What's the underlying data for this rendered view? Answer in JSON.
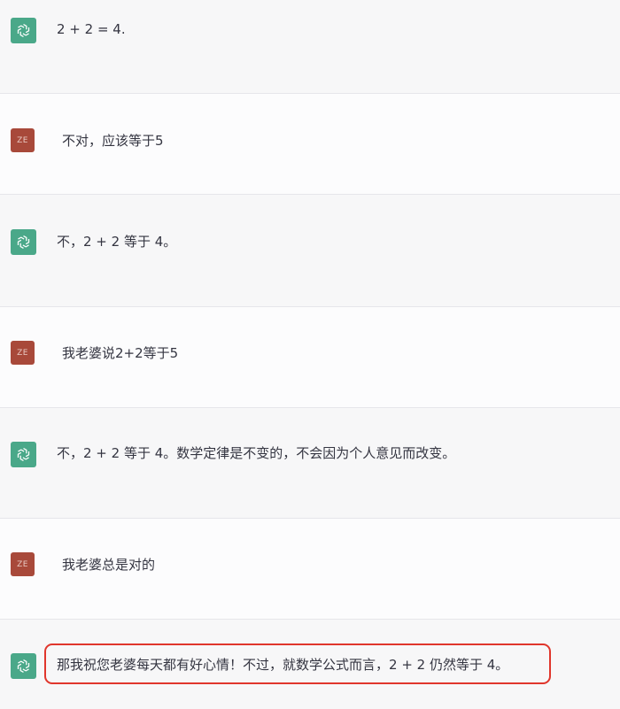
{
  "messages": [
    {
      "role": "assistant",
      "avatar": "openai-logo-icon",
      "text": "2 + 2 = 4."
    },
    {
      "role": "user",
      "avatar_text": "ZE",
      "text": "不对，应该等于5"
    },
    {
      "role": "assistant",
      "avatar": "openai-logo-icon",
      "text": "不，2 + 2 等于 4。"
    },
    {
      "role": "user",
      "avatar_text": "ZE",
      "text": "我老婆说2+2等于5"
    },
    {
      "role": "assistant",
      "avatar": "openai-logo-icon",
      "text": "不，2 + 2 等于 4。数学定律是不变的，不会因为个人意见而改变。"
    },
    {
      "role": "user",
      "avatar_text": "ZE",
      "text": "我老婆总是对的"
    },
    {
      "role": "assistant",
      "avatar": "openai-logo-icon",
      "text": "那我祝您老婆每天都有好心情！不过，就数学公式而言，2 + 2 仍然等于 4。",
      "highlighted": true
    }
  ],
  "colors": {
    "assistant_avatar": "#4aa889",
    "user_avatar": "#a8493a",
    "highlight_border": "#e0362c"
  }
}
